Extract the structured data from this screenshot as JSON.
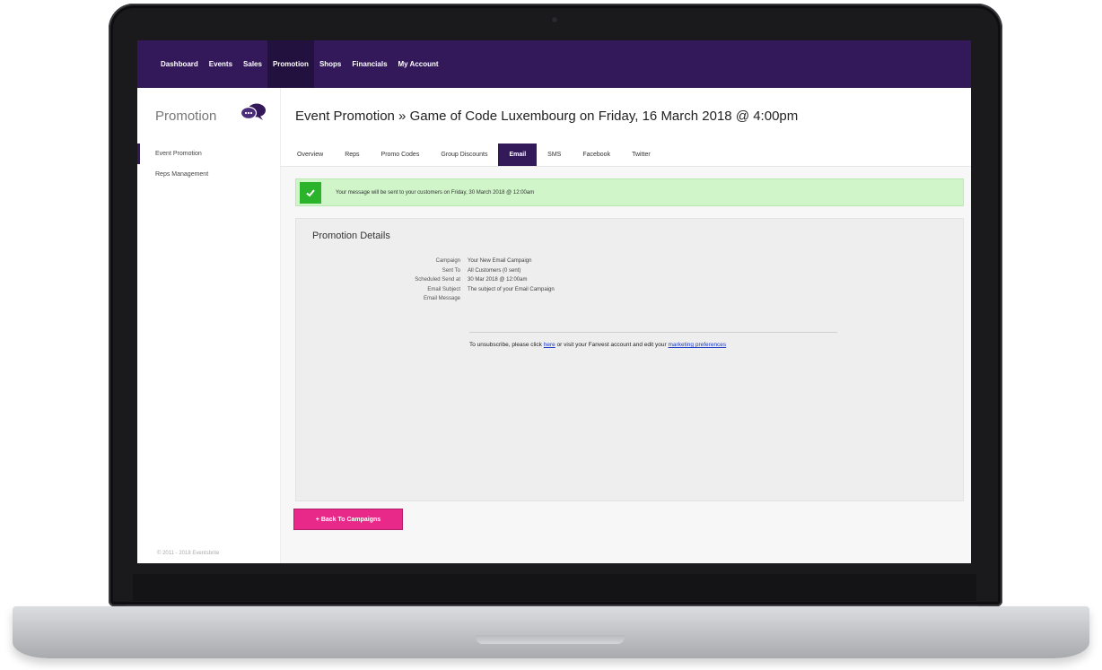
{
  "nav": {
    "items": [
      {
        "label": "Dashboard"
      },
      {
        "label": "Events"
      },
      {
        "label": "Sales"
      },
      {
        "label": "Promotion",
        "active": true
      },
      {
        "label": "Shops"
      },
      {
        "label": "Financials"
      },
      {
        "label": "My Account"
      }
    ]
  },
  "sidebar": {
    "title": "Promotion",
    "icon": "chat-bubbles-icon",
    "links": [
      {
        "label": "Event Promotion",
        "active": true
      },
      {
        "label": "Reps Management"
      }
    ],
    "footer": "© 2011 - 2018 Eventsbrite"
  },
  "main": {
    "title": "Event Promotion » Game of Code Luxembourg on Friday, 16 March 2018 @ 4:00pm",
    "tabs": [
      {
        "label": "Overview"
      },
      {
        "label": "Reps"
      },
      {
        "label": "Promo Codes"
      },
      {
        "label": "Group Discounts"
      },
      {
        "label": "Email",
        "active": true
      },
      {
        "label": "SMS"
      },
      {
        "label": "Facebook"
      },
      {
        "label": "Twitter"
      }
    ],
    "alert": "Your message will be sent to your customers on Friday, 30 March 2018 @ 12:00am",
    "panel": {
      "title": "Promotion Details",
      "rows": [
        {
          "key": "Campaign",
          "value": "Your New Email Campaign"
        },
        {
          "key": "Sent To",
          "value": "All Customers (0 sent)"
        },
        {
          "key": "Scheduled Send at",
          "value": "30 Mar 2018 @ 12:00am"
        },
        {
          "key": "Email Subject",
          "value": "The subject of your Email Campaign"
        },
        {
          "key": "Email Message",
          "value": ""
        }
      ],
      "unsubscribe": {
        "prefix": "To unsubscribe, please click ",
        "link1": "here",
        "middle": " or visit your Fanvest account and edit your ",
        "link2": "marketing preferences"
      }
    },
    "back_button": "+ Back To Campaigns"
  },
  "colors": {
    "nav_bg": "#33195a",
    "accent_pink": "#e8298a",
    "success_bg": "#cff5c9",
    "success_check": "#2bb32b"
  }
}
